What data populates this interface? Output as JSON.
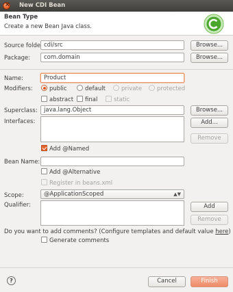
{
  "window": {
    "title": "New CDI Bean"
  },
  "header": {
    "title": "Bean Type",
    "subtitle": "Create a new Bean Java class."
  },
  "source_folder": {
    "label": "Source folder:",
    "value": "cdi/src",
    "browse": "Browse..."
  },
  "package": {
    "label": "Package:",
    "value": "com.domain",
    "browse": "Browse..."
  },
  "name": {
    "label": "Name:",
    "value": "Product"
  },
  "modifiers": {
    "label": "Modifiers:",
    "public": "public",
    "default": "default",
    "private": "private",
    "protected": "protected",
    "abstract": "abstract",
    "final": "final",
    "static": "static",
    "selected": "public"
  },
  "superclass": {
    "label": "Superclass:",
    "value": "java.lang.Object",
    "browse": "Browse..."
  },
  "interfaces": {
    "label": "Interfaces:",
    "add": "Add...",
    "remove": "Remove"
  },
  "add_named": {
    "label": "Add @Named",
    "checked": true
  },
  "bean_name": {
    "label": "Bean Name:",
    "value": ""
  },
  "add_alternative": {
    "label": "Add @Alternative",
    "checked": false
  },
  "register_beans": {
    "label": "Register in beans.xml",
    "checked": false
  },
  "scope": {
    "label": "Scope:",
    "value": "@ApplicationScoped"
  },
  "qualifier": {
    "label": "Qualifier:",
    "add": "Add",
    "remove": "Remove"
  },
  "comments": {
    "question": "Do you want to add comments? (Configure templates and default value ",
    "link": "here",
    "suffix": ")",
    "generate": "Generate comments"
  },
  "footer": {
    "help": "?",
    "cancel": "Cancel",
    "finish": "Finish"
  },
  "colors": {
    "accent": "#e15a25",
    "finish": "#ef8a68"
  }
}
